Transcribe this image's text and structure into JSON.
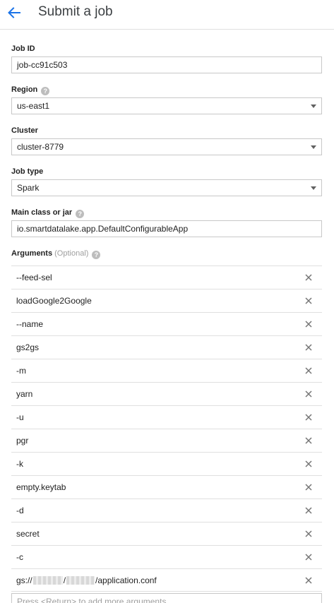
{
  "header": {
    "title": "Submit a job",
    "back_icon": "arrow-back-icon",
    "accent": "#1a73e8"
  },
  "job_id": {
    "label": "Job ID",
    "value": "job-cc91c503"
  },
  "region": {
    "label": "Region",
    "help_icon": "help-icon",
    "value": "us-east1"
  },
  "cluster": {
    "label": "Cluster",
    "value": "cluster-8779"
  },
  "job_type": {
    "label": "Job type",
    "value": "Spark"
  },
  "main_class": {
    "label": "Main class or jar",
    "help_icon": "help-icon",
    "value": "io.smartdatalake.app.DefaultConfigurableApp"
  },
  "arguments": {
    "label": "Arguments",
    "optional": "(Optional)",
    "help_icon": "help-icon",
    "remove_icon": "close-icon",
    "items": [
      "--feed-sel",
      "loadGoogle2Google",
      "--name",
      "gs2gs",
      "-m",
      "yarn",
      "-u",
      "pgr",
      "-k",
      "empty.keytab",
      "-d",
      "secret",
      "-c"
    ],
    "last_item": {
      "prefix": "gs://",
      "sep": "/",
      "suffix": "/application.conf"
    },
    "add_placeholder": "Press <Return> to add more arguments"
  }
}
